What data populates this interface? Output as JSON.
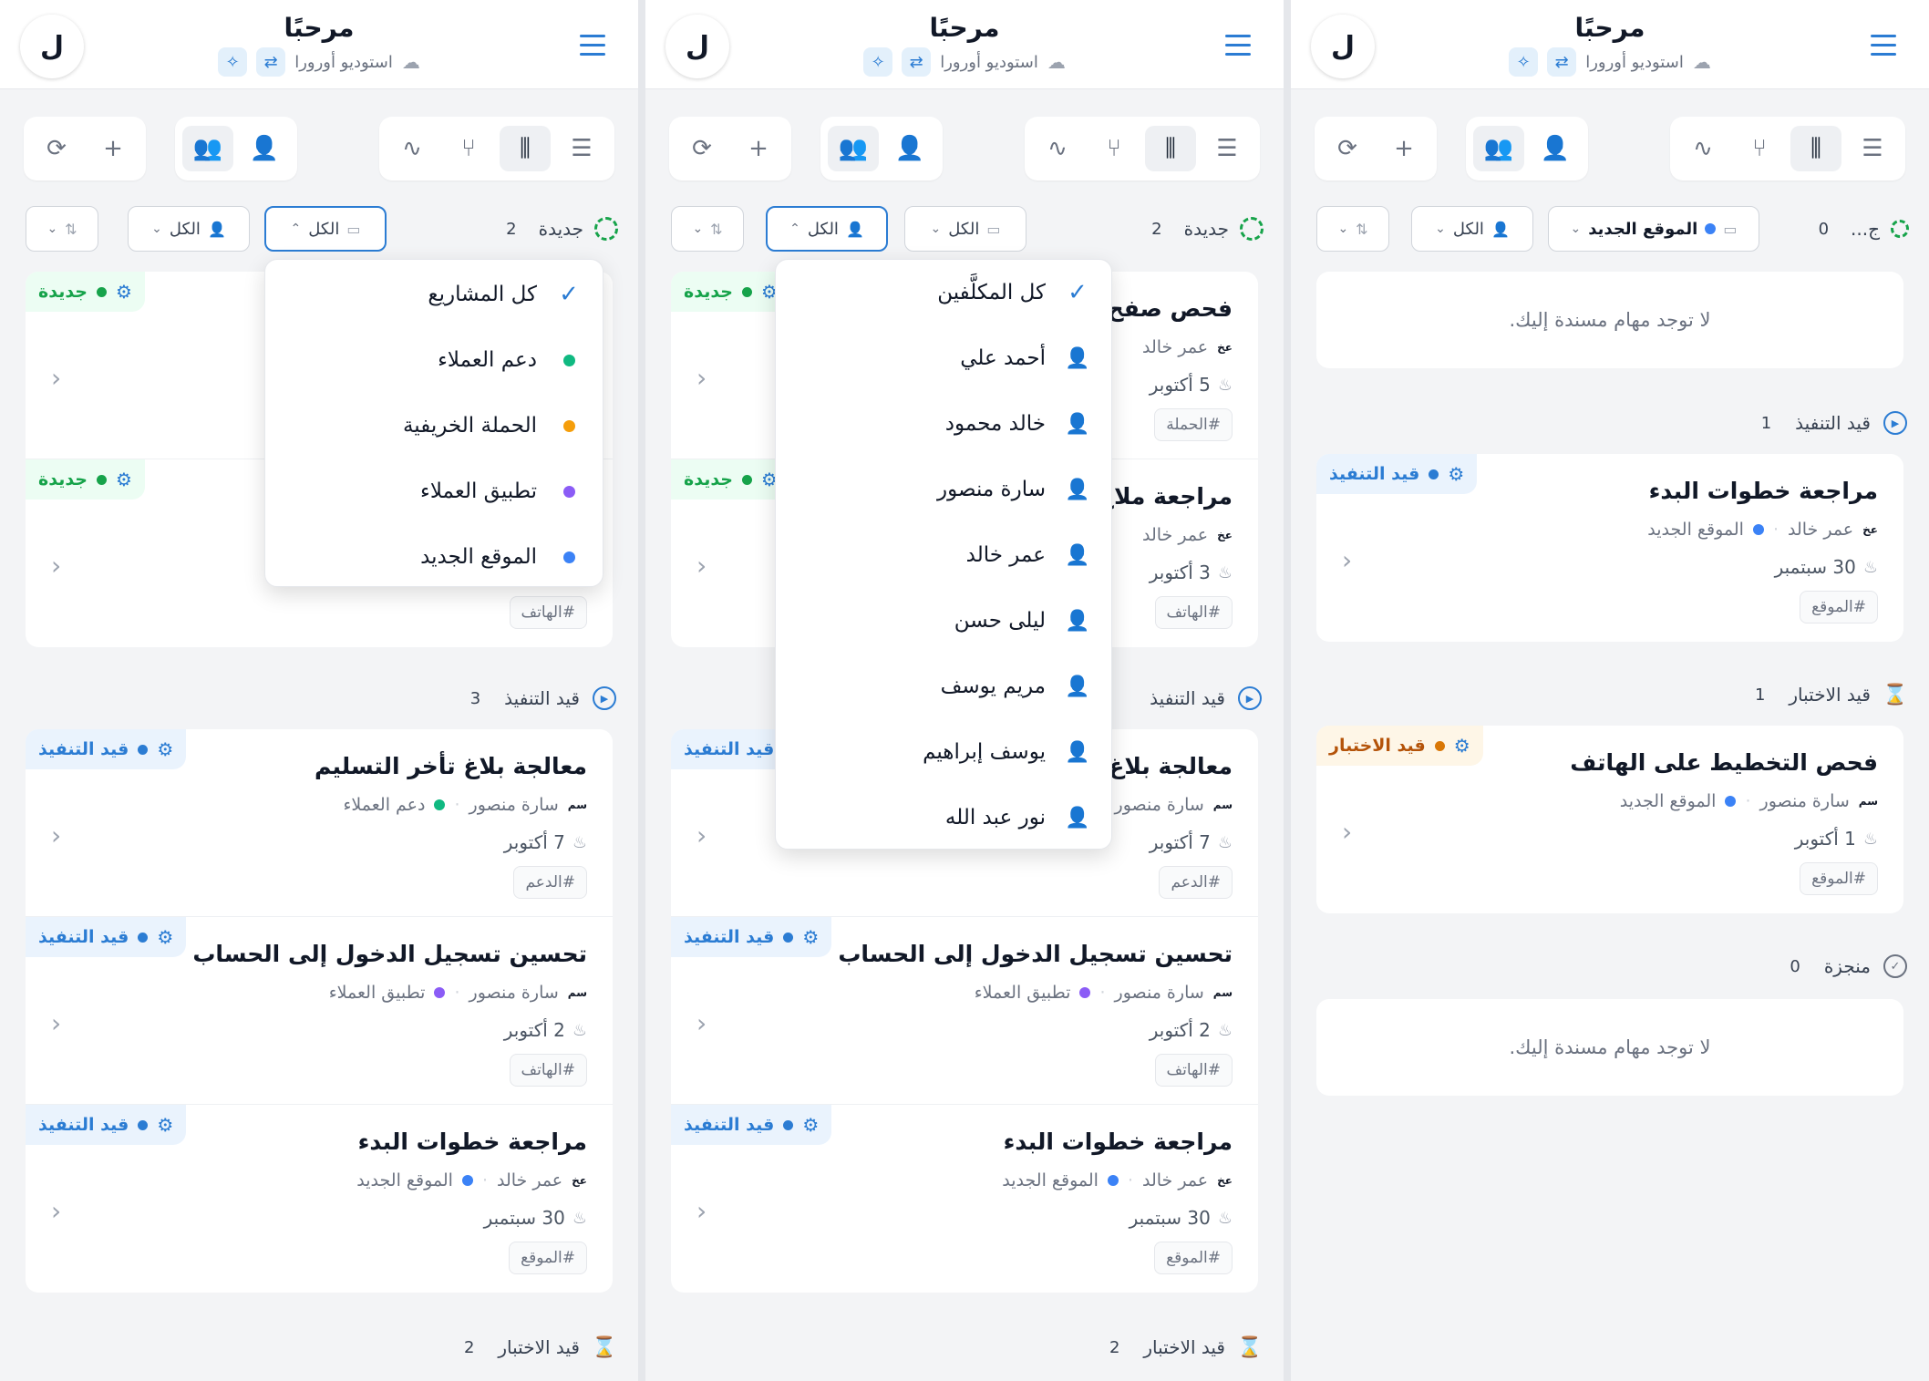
{
  "header": {
    "greeting": "مرحبًا",
    "workspace": "استوديو أورورا",
    "avatar_letter": "ل"
  },
  "filters": {
    "all": "الكل",
    "new_site": "الموقع الجديد"
  },
  "sections": {
    "new": "جديدة",
    "new_truncated": "ج...",
    "in_progress": "قيد التنفيذ",
    "testing": "قيد الاختبار",
    "done": "منجزة"
  },
  "badges": {
    "new": "جديدة",
    "in_progress": "قيد التنفيذ",
    "testing": "قيد الاختبار"
  },
  "colors": {
    "accent": "#2b7cd3",
    "new": "#16a34a",
    "testing": "#d97706",
    "support": "#10b981",
    "autumn": "#f59e0b",
    "app": "#8b5cf6",
    "site": "#3b82f6"
  },
  "project_menu": [
    {
      "label": "كل المشاريع",
      "icon": "check-icon"
    },
    {
      "label": "دعم العملاء",
      "color": "#10b981"
    },
    {
      "label": "الحملة الخريفية",
      "color": "#f59e0b"
    },
    {
      "label": "تطبيق العملاء",
      "color": "#8b5cf6"
    },
    {
      "label": "الموقع الجديد",
      "color": "#3b82f6"
    }
  ],
  "assignee_menu": [
    {
      "label": "كل المكلَّفين",
      "icon": "check-icon"
    },
    {
      "label": "أحمد علي"
    },
    {
      "label": "خالد محمود"
    },
    {
      "label": "سارة منصور"
    },
    {
      "label": "عمر خالد"
    },
    {
      "label": "ليلى حسن"
    },
    {
      "label": "مريم يوسف"
    },
    {
      "label": "يوسف إبراهيم"
    },
    {
      "label": "نور عبد الله"
    }
  ],
  "panel1": {
    "new_count": "2",
    "progress_count": "3",
    "testing_count": "2",
    "new_cards": [
      {
        "tag": "#الهاتف"
      }
    ],
    "progress_cards": [
      {
        "title": "معالجة بلاغ تأخر التسليم",
        "initials": "سم",
        "assignee": "سارة منصور",
        "project": "دعم العملاء",
        "date": "7 أكتوبر",
        "tag": "#الدعم"
      },
      {
        "title": "تحسين تسجيل الدخول إلى الحساب",
        "initials": "سم",
        "assignee": "سارة منصور",
        "project": "تطبيق العملاء",
        "date": "2 أكتوبر",
        "tag": "#الهاتف"
      },
      {
        "title": "مراجعة خطوات البدء",
        "initials": "عخ",
        "assignee": "عمر خالد",
        "project": "الموقع الجديد",
        "date": "30 سبتمبر",
        "tag": "#الموقع"
      }
    ]
  },
  "panel2": {
    "new_count": "2",
    "testing_count": "2",
    "new_cards": [
      {
        "title": "فحص صفح",
        "initials": "عخ",
        "assignee": "عمر خالد",
        "date": "5 أكتوبر",
        "tag": "#الحملة"
      },
      {
        "title": "مراجعة ملاح",
        "initials": "عخ",
        "assignee": "عمر خالد",
        "date": "3 أكتوبر",
        "tag": "#الهاتف"
      }
    ],
    "progress_cards": [
      {
        "title": "معالجة بلاغ",
        "initials": "سم",
        "assignee": "سارة منصور",
        "date": "7 أكتوبر",
        "tag": "#الدعم"
      },
      {
        "title": "تحسين تسجيل الدخول إلى الحساب",
        "initials": "سم",
        "assignee": "سارة منصور",
        "project": "تطبيق العملاء",
        "date": "2 أكتوبر",
        "tag": "#الهاتف"
      },
      {
        "title": "مراجعة خطوات البدء",
        "initials": "عخ",
        "assignee": "عمر خالد",
        "project": "الموقع الجديد",
        "date": "30 سبتمبر",
        "tag": "#الموقع"
      }
    ]
  },
  "panel3": {
    "new_count": "0",
    "progress_count": "1",
    "testing_count": "1",
    "done_count": "0",
    "empty_text": "لا توجد مهام مسندة إليك.",
    "progress_card": {
      "title": "مراجعة خطوات البدء",
      "initials": "عخ",
      "assignee": "عمر خالد",
      "project": "الموقع الجديد",
      "date": "30 سبتمبر",
      "tag": "#الموقع"
    },
    "testing_card": {
      "title": "فحص التخطيط على الهاتف",
      "initials": "سم",
      "assignee": "سارة منصور",
      "project": "الموقع الجديد",
      "date": "1 أكتوبر",
      "tag": "#الموقع"
    }
  }
}
